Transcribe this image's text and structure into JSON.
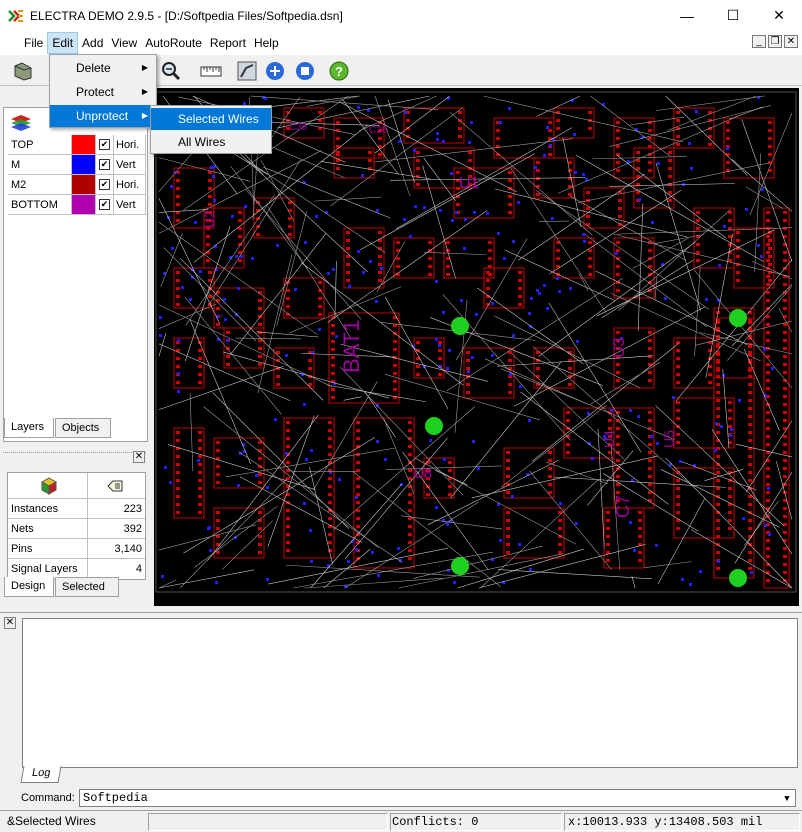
{
  "window": {
    "title": "ELECTRA DEMO 2.9.5 - [D:/Softpedia Files/Softpedia.dsn]",
    "minimize": "—",
    "maximize": "☐",
    "close": "✕"
  },
  "menubar": {
    "items": [
      "File",
      "Edit",
      "Add",
      "View",
      "AutoRoute",
      "Report",
      "Help"
    ]
  },
  "edit_menu": {
    "items": [
      {
        "label": "Delete"
      },
      {
        "label": "Protect"
      },
      {
        "label": "Unprotect"
      }
    ],
    "submenu": {
      "items": [
        "Selected Wires",
        "All Wires"
      ]
    }
  },
  "toolbar": {
    "icons": [
      "open-icon",
      "zoom-icon",
      "ruler-icon",
      "route-icon",
      "wire-icon",
      "stop-icon",
      "help-icon"
    ]
  },
  "layers_panel": {
    "rows": [
      {
        "name": "TOP",
        "color": "#ff0000",
        "dir": "Hori."
      },
      {
        "name": "M",
        "color": "#0000ff",
        "dir": "Vert"
      },
      {
        "name": "M2",
        "color": "#b00000",
        "dir": "Hori."
      },
      {
        "name": "BOTTOM",
        "color": "#b000b0",
        "dir": "Vert"
      }
    ],
    "tabs": [
      "Layers",
      "Objects"
    ]
  },
  "design_panel": {
    "rows": [
      {
        "label": "Instances",
        "value": "223"
      },
      {
        "label": "Nets",
        "value": "392"
      },
      {
        "label": "Pins",
        "value": "3,140"
      },
      {
        "label": "Signal Layers",
        "value": "4"
      }
    ],
    "tabs": [
      "Design",
      "Selected"
    ]
  },
  "pcb_labels": [
    "BAT1",
    "U2",
    "U1",
    "U3",
    "U4",
    "U5",
    "C7",
    "U8",
    "C35",
    "C36"
  ],
  "log": {
    "tab": "Log",
    "command_label": "Command:",
    "command_value": "Softpedia"
  },
  "status": {
    "hint": "&Selected Wires",
    "conflicts": "Conflicts: 0",
    "coords": "x:10013.933 y:13408.503 mil"
  }
}
